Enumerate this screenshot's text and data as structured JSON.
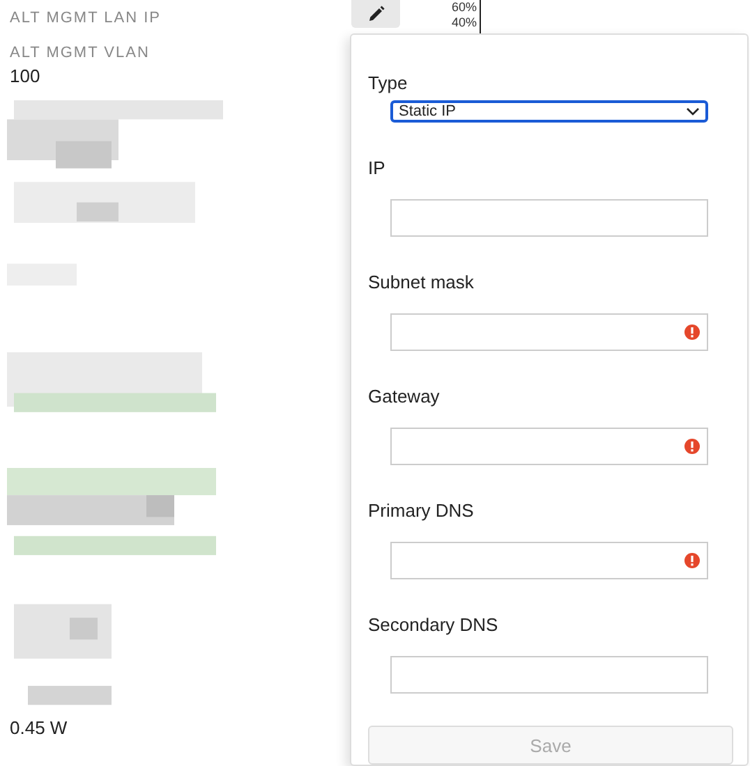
{
  "details": [
    {
      "label": "ALT MGMT LAN IP"
    },
    {
      "label": "ALT MGMT VLAN",
      "value": "100"
    }
  ],
  "footer_value": "0.45 W",
  "chart": {
    "ticks": [
      "60%",
      "40%"
    ]
  },
  "popover": {
    "type_label": "Type",
    "type_select": {
      "value": "Static IP",
      "focused": true
    },
    "fields": [
      {
        "label": "IP",
        "error": false
      },
      {
        "label": "Subnet mask",
        "error": true
      },
      {
        "label": "Gateway",
        "error": true
      },
      {
        "label": "Primary DNS",
        "error": true
      },
      {
        "label": "Secondary DNS",
        "error": false
      }
    ],
    "save": {
      "label": "Save",
      "disabled": true
    }
  }
}
